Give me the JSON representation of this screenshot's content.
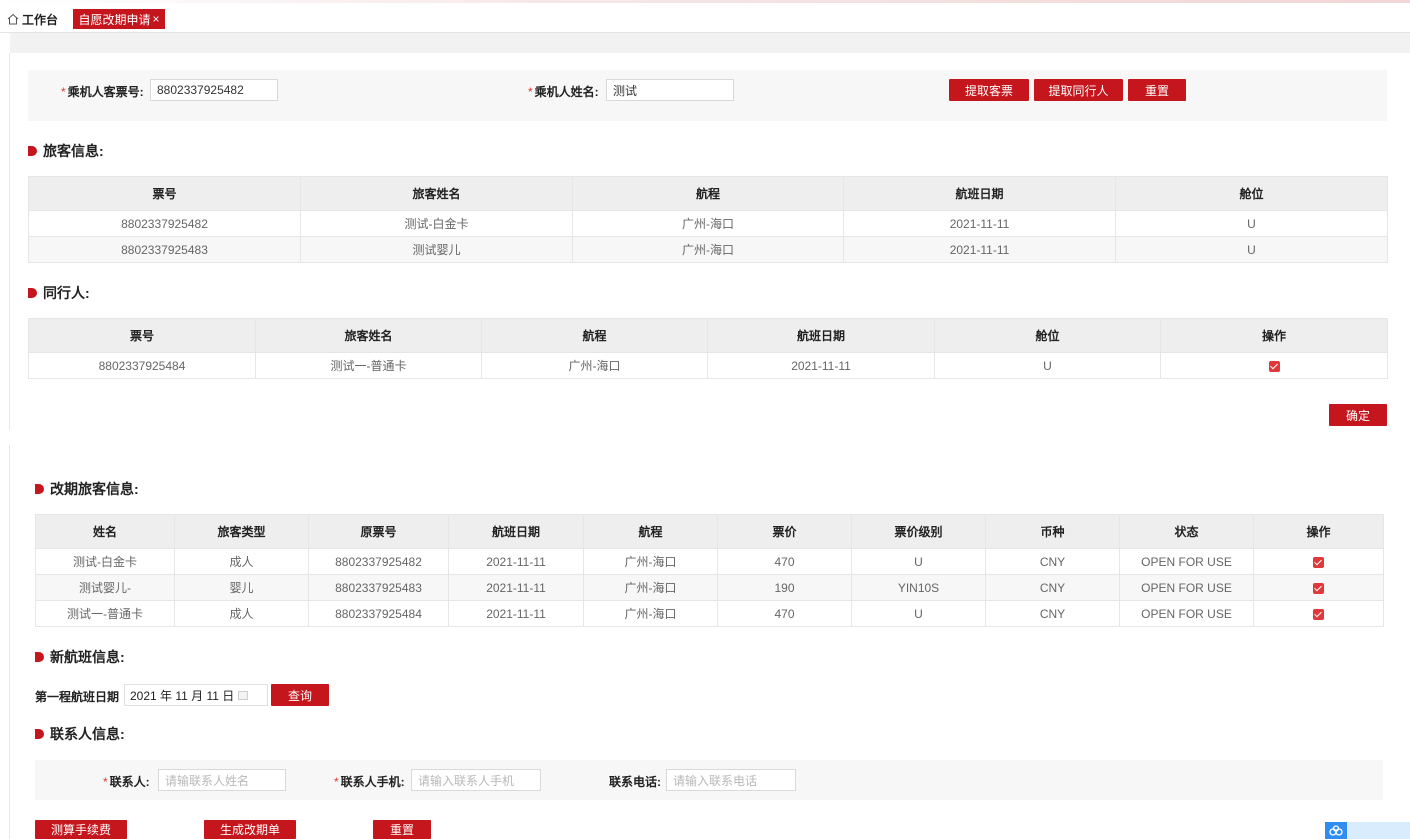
{
  "tabs": {
    "home_label": "工作台",
    "active_label": "自愿改期申请",
    "close_glyph": "×"
  },
  "search": {
    "ticket_label": "乘机人客票号:",
    "ticket_value": "8802337925482",
    "name_label": "乘机人姓名:",
    "name_value": "测试",
    "required_mark": "*",
    "buttons": {
      "fetch_ticket": "提取客票",
      "fetch_companion": "提取同行人",
      "reset": "重置"
    }
  },
  "passenger_info": {
    "title": "旅客信息:",
    "headers": [
      "票号",
      "旅客姓名",
      "航程",
      "航班日期",
      "舱位"
    ],
    "rows": [
      [
        "8802337925482",
        "测试-白金卡",
        "广州-海口",
        "2021-11-11",
        "U"
      ],
      [
        "8802337925483",
        "测试婴儿",
        "广州-海口",
        "2021-11-11",
        "U"
      ]
    ]
  },
  "companions": {
    "title": "同行人:",
    "headers": [
      "票号",
      "旅客姓名",
      "航程",
      "航班日期",
      "舱位",
      "操作"
    ],
    "rows": [
      [
        "8802337925484",
        "测试一-普通卡",
        "广州-海口",
        "2021-11-11",
        "U"
      ]
    ],
    "confirm_label": "确定"
  },
  "change_passengers": {
    "title": "改期旅客信息:",
    "headers": [
      "姓名",
      "旅客类型",
      "原票号",
      "航班日期",
      "航程",
      "票价",
      "票价级别",
      "币种",
      "状态",
      "操作"
    ],
    "rows": [
      [
        "测试-白金卡",
        "成人",
        "8802337925482",
        "2021-11-11",
        "广州-海口",
        "470",
        "U",
        "CNY",
        "OPEN FOR USE"
      ],
      [
        "测试婴儿-",
        "婴儿",
        "8802337925483",
        "2021-11-11",
        "广州-海口",
        "190",
        "YIN10S",
        "CNY",
        "OPEN FOR USE"
      ],
      [
        "测试一-普通卡",
        "成人",
        "8802337925484",
        "2021-11-11",
        "广州-海口",
        "470",
        "U",
        "CNY",
        "OPEN FOR USE"
      ]
    ]
  },
  "new_flight": {
    "title": "新航班信息:",
    "date_label": "第一程航班日期",
    "date_value": "2021 年 11 月 11 日",
    "query_label": "查询"
  },
  "contact": {
    "title": "联系人信息:",
    "name_label": "联系人:",
    "name_placeholder": "请输联系人姓名",
    "mobile_label": "联系人手机:",
    "mobile_placeholder": "请输入联系人手机",
    "phone_label": "联系电话:",
    "phone_placeholder": "请输入联系电话"
  },
  "actions": {
    "calc_fee": "测算手续费",
    "generate_order": "生成改期单",
    "reset": "重置"
  },
  "colors": {
    "accent": "#c4161c",
    "header_bg": "#eeeeee",
    "panel_bg": "#f7f7f7"
  }
}
